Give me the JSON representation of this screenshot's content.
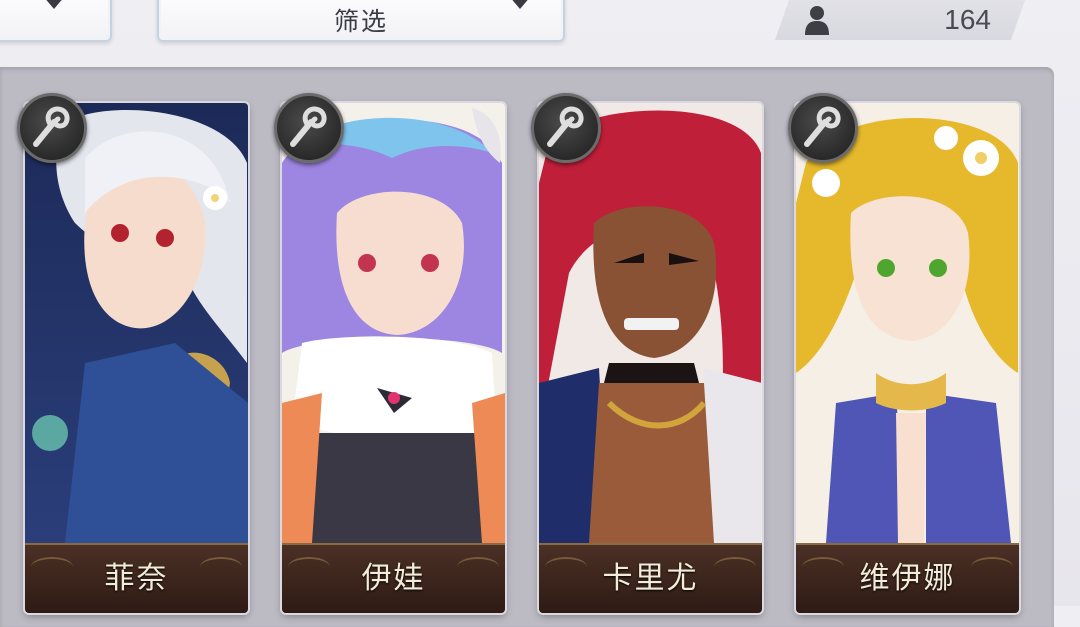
{
  "header": {
    "left_dropdown_label": "",
    "filter_label": "筛选",
    "player_count": "164"
  },
  "icons": {
    "dropdown_chevron": "chevron-down-icon",
    "player": "person-icon",
    "class_badge": "staff-icon"
  },
  "cards": [
    {
      "name": "菲奈",
      "art": "silver-haired-girl-with-flower"
    },
    {
      "name": "伊娃",
      "art": "blue-purple-haired-girl-with-horns"
    },
    {
      "name": "卡里尤",
      "art": "red-haired-man-with-chain"
    },
    {
      "name": "维伊娜",
      "art": "blonde-girl-with-flowers"
    }
  ],
  "colors": {
    "panel": "#bcbac3",
    "nameplate": "#3a2219",
    "name_text": "#f3ecd9"
  }
}
